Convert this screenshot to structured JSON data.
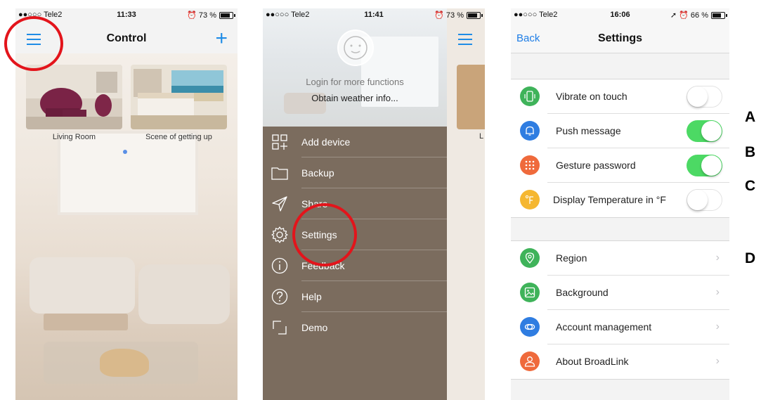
{
  "colors": {
    "ios_blue": "#1f8ce6",
    "toggle_on": "#4cd964",
    "highlight_circle": "#e3141b",
    "menu_bg": "#7b6c5e"
  },
  "screen1": {
    "status": {
      "carrier": "●●○○○ Tele2 ",
      "time": "11:33",
      "battery_text": "73 %",
      "battery_level": 0.73
    },
    "title": "Control",
    "menu_icon": "hamburger-icon",
    "add_icon": "plus-icon",
    "add_glyph": "+",
    "scenes": [
      {
        "label": "Living Room"
      },
      {
        "label": "Scene of getting up"
      }
    ],
    "page_indicator": {
      "current": 1
    }
  },
  "screen2": {
    "status": {
      "carrier": "●●○○○ Tele2 ",
      "time": "11:41",
      "battery_text": "73 %",
      "battery_level": 0.73
    },
    "login_text": "Login for more functions",
    "weather_text": "Obtain weather info...",
    "menu_items": [
      {
        "label": "Add device",
        "icon": "add-device-icon"
      },
      {
        "label": "Backup",
        "icon": "folder-icon"
      },
      {
        "label": "Share",
        "icon": "send-icon"
      },
      {
        "label": "Settings",
        "icon": "gear-icon"
      },
      {
        "label": "Feedback",
        "icon": "info-icon"
      },
      {
        "label": "Help",
        "icon": "question-icon"
      },
      {
        "label": "Demo",
        "icon": "demo-icon"
      }
    ],
    "peek_letter": "L"
  },
  "screen3": {
    "status": {
      "carrier": "●●○○○ Tele2 ",
      "time": "16:06",
      "battery_text": "66 %",
      "battery_level": 0.66
    },
    "back_label": "Back",
    "title": "Settings",
    "toggles": [
      {
        "label": "Vibrate on touch",
        "on": false,
        "icon": "vibrate-icon",
        "color": "#3fb35a"
      },
      {
        "label": "Push message",
        "on": true,
        "icon": "bell-icon",
        "color": "#2f7de1"
      },
      {
        "label": "Gesture password",
        "on": true,
        "icon": "gesture-grid-icon",
        "color": "#ef6a3c"
      },
      {
        "label": "Display Temperature in °F",
        "on": false,
        "icon": "fahrenheit-icon",
        "color": "#f5b731"
      }
    ],
    "links": [
      {
        "label": "Region",
        "icon": "location-pin-icon",
        "color": "#3fb35a"
      },
      {
        "label": "Background",
        "icon": "image-icon",
        "color": "#3fb35a"
      },
      {
        "label": "Account management",
        "icon": "account-cloud-icon",
        "color": "#2f7de1"
      },
      {
        "label": "About BroadLink",
        "icon": "person-icon",
        "color": "#ef6a3c"
      }
    ],
    "chevron": "›"
  },
  "markers": [
    "A",
    "B",
    "C",
    "D"
  ]
}
